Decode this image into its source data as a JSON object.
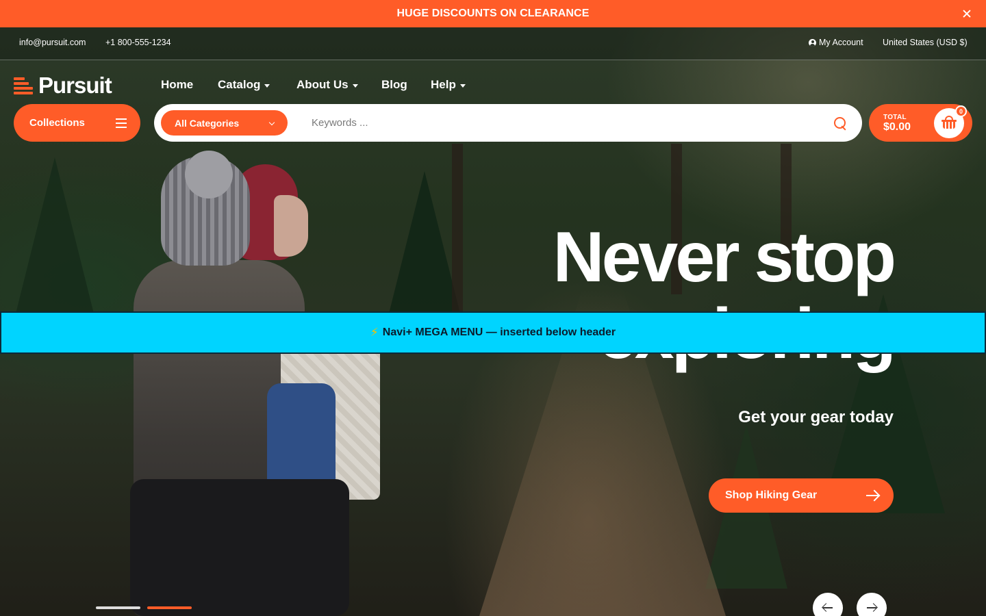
{
  "announcement": {
    "text": "HUGE DISCOUNTS ON CLEARANCE"
  },
  "utility": {
    "email": "info@pursuit.com",
    "phone": "+1 800-555-1234",
    "account": "My Account",
    "currency": "United States (USD $)"
  },
  "brand": {
    "name": "Pursuit",
    "accent": "#ff5c28"
  },
  "nav": {
    "home": "Home",
    "catalog": "Catalog",
    "about": "About Us",
    "blog": "Blog",
    "help": "Help"
  },
  "search": {
    "collections": "Collections",
    "category": "All Categories",
    "placeholder": "Keywords ..."
  },
  "cart": {
    "label": "TOTAL",
    "total": "$0.00",
    "count": "0"
  },
  "hero": {
    "title": "Never stop exploring",
    "subtitle": "Get your gear today",
    "cta": "Shop Hiking Gear",
    "active_slide": 2,
    "slide_count": 2
  },
  "mega_menu": {
    "text": "Navi+ MEGA MENU — inserted below header",
    "accent": "#00d4ff"
  }
}
